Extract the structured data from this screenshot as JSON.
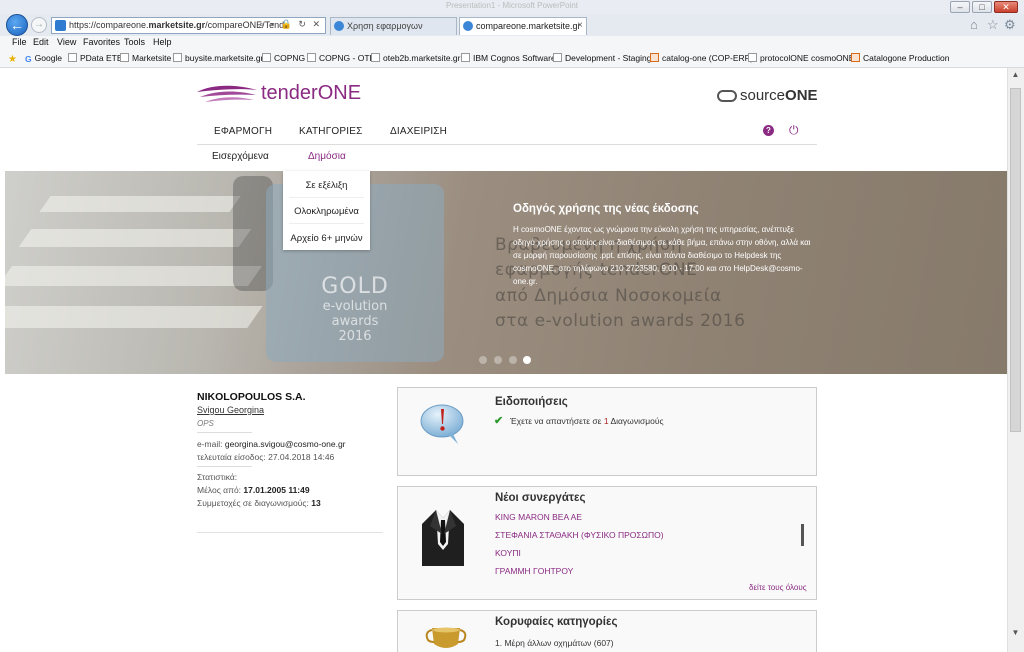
{
  "browser": {
    "window_title": "Presentation1 - Microsoft PowerPoint",
    "url_prefix": "https://compareone.",
    "url_host": "marketsite.gr",
    "url_path": "/compareONE/TenderONE/c",
    "address_tools": "⌕ ▾ 🔒 ↻ ✕",
    "tabs": [
      {
        "label": "Χρηση εφαρμογων"
      },
      {
        "label": "compareone.marketsite.gr"
      }
    ],
    "tab_close": "×",
    "menus": [
      "File",
      "Edit",
      "View",
      "Favorites",
      "Tools",
      "Help"
    ],
    "bookmarks": [
      "Google",
      "PData ETE",
      "Marketsite",
      "buysite.marketsite.gr",
      "COPNG",
      "COPNG - OTE",
      "oteb2b.marketsite.gr",
      "IBM Cognos Software",
      "Development - Staging",
      "catalog-one (COP-ERP)",
      "protocolONE cosmoONE",
      "Catalogone Production"
    ]
  },
  "header": {
    "logo_main": "tender",
    "logo_accent": "ONE",
    "source_logo_light": "source",
    "source_logo_bold": "ONE",
    "nav": [
      "ΕΦΑΡΜΟΓΗ",
      "ΚΑΤΗΓΟΡΙΕΣ",
      "ΔΙΑΧΕΙΡΙΣΗ"
    ],
    "subnav": [
      "Εισερχόμενα",
      "Δημόσια"
    ],
    "help_glyph": "?",
    "power_glyph": "⏻"
  },
  "dropdown": {
    "items": [
      "Σε εξέλιξη",
      "Ολοκληρωμένα",
      "Αρχείο 6+ μηνών"
    ]
  },
  "banner": {
    "badge_gold": "GOLD",
    "badge_lines": [
      "e-volution",
      "awards",
      "2016"
    ],
    "ghost_lines": [
      "Βραβευμένη η χρήση",
      "εφαρμογής tenderONE",
      "από Δημόσια Νοσοκομεία",
      "στα e-volution awards 2016"
    ],
    "title": "Οδηγός χρήσης της νέας έκδοσης",
    "text": "Η cosmoONE έχοντας ως γνώμονα την εύκολη χρήση της υπηρεσίας, ανέπτυξε οδηγό χρήσης ο οποίος είναι διαθέσιμος σε κάθε βήμα, επάνω στην οθόνη, αλλά και σε μορφή παρουσίασης .ppt. επίσης, είναι πάντα διαθέσιμο το Helpdesk της cosmoONE, στο τηλέφωνο 210 2723580, 9:00 - 17:00 και στο HelpDesk@cosmo-one.gr.",
    "slides": 4,
    "active_slide": 4
  },
  "user": {
    "company": "NIKOLOPOULOS S.A.",
    "name": "Svigou Georgina",
    "role": "OPS",
    "email_label": "e-mail:",
    "email": "georgina.svigou@cosmo-one.gr",
    "last_login_label": "τελευταία είσοδος:",
    "last_login": "27.04.2018 14:46",
    "stats_label": "Στατιστικά:",
    "member_since_label": "Μέλος από:",
    "member_since": "17.01.2005 11:49",
    "participations_label": "Συμμετοχές σε διαγωνισμούς:",
    "participations": "13"
  },
  "notifications": {
    "title": "Ειδοποιήσεις",
    "check": "✔",
    "text_before": "Έχετε να απαντήσετε σε",
    "count": "1",
    "text_after": "Διαγωνισμούς"
  },
  "partners": {
    "title": "Νέοι συνεργάτες",
    "items": [
      "KING MARON ΒΕΑ ΑΕ",
      "ΣΤΕΦΑΝΙΑ ΣΤΑΘΑΚΗ (ΦΥΣΙΚΟ ΠΡΟΣΩΠΟ)",
      "ΚΟΥΠΙ",
      "ΓΡΑΜΜΗ ΓΟΗΤΡΟΥ"
    ],
    "see_all": "δείτε τους όλους"
  },
  "categories": {
    "title": "Κορυφαίες κατηγορίες",
    "first_item": "1. Μέρη άλλων οχημάτων (607)"
  },
  "colors": {
    "brand": "#8a2a82",
    "check": "#2e9a2e",
    "banner_text": "#ffffff"
  },
  "icons": [
    "back-arrow-icon",
    "forward-arrow-icon",
    "home-icon",
    "star-icon",
    "gear-icon",
    "help-icon",
    "power-icon",
    "alert-bubble-icon",
    "tuxedo-icon",
    "trophy-icon"
  ]
}
